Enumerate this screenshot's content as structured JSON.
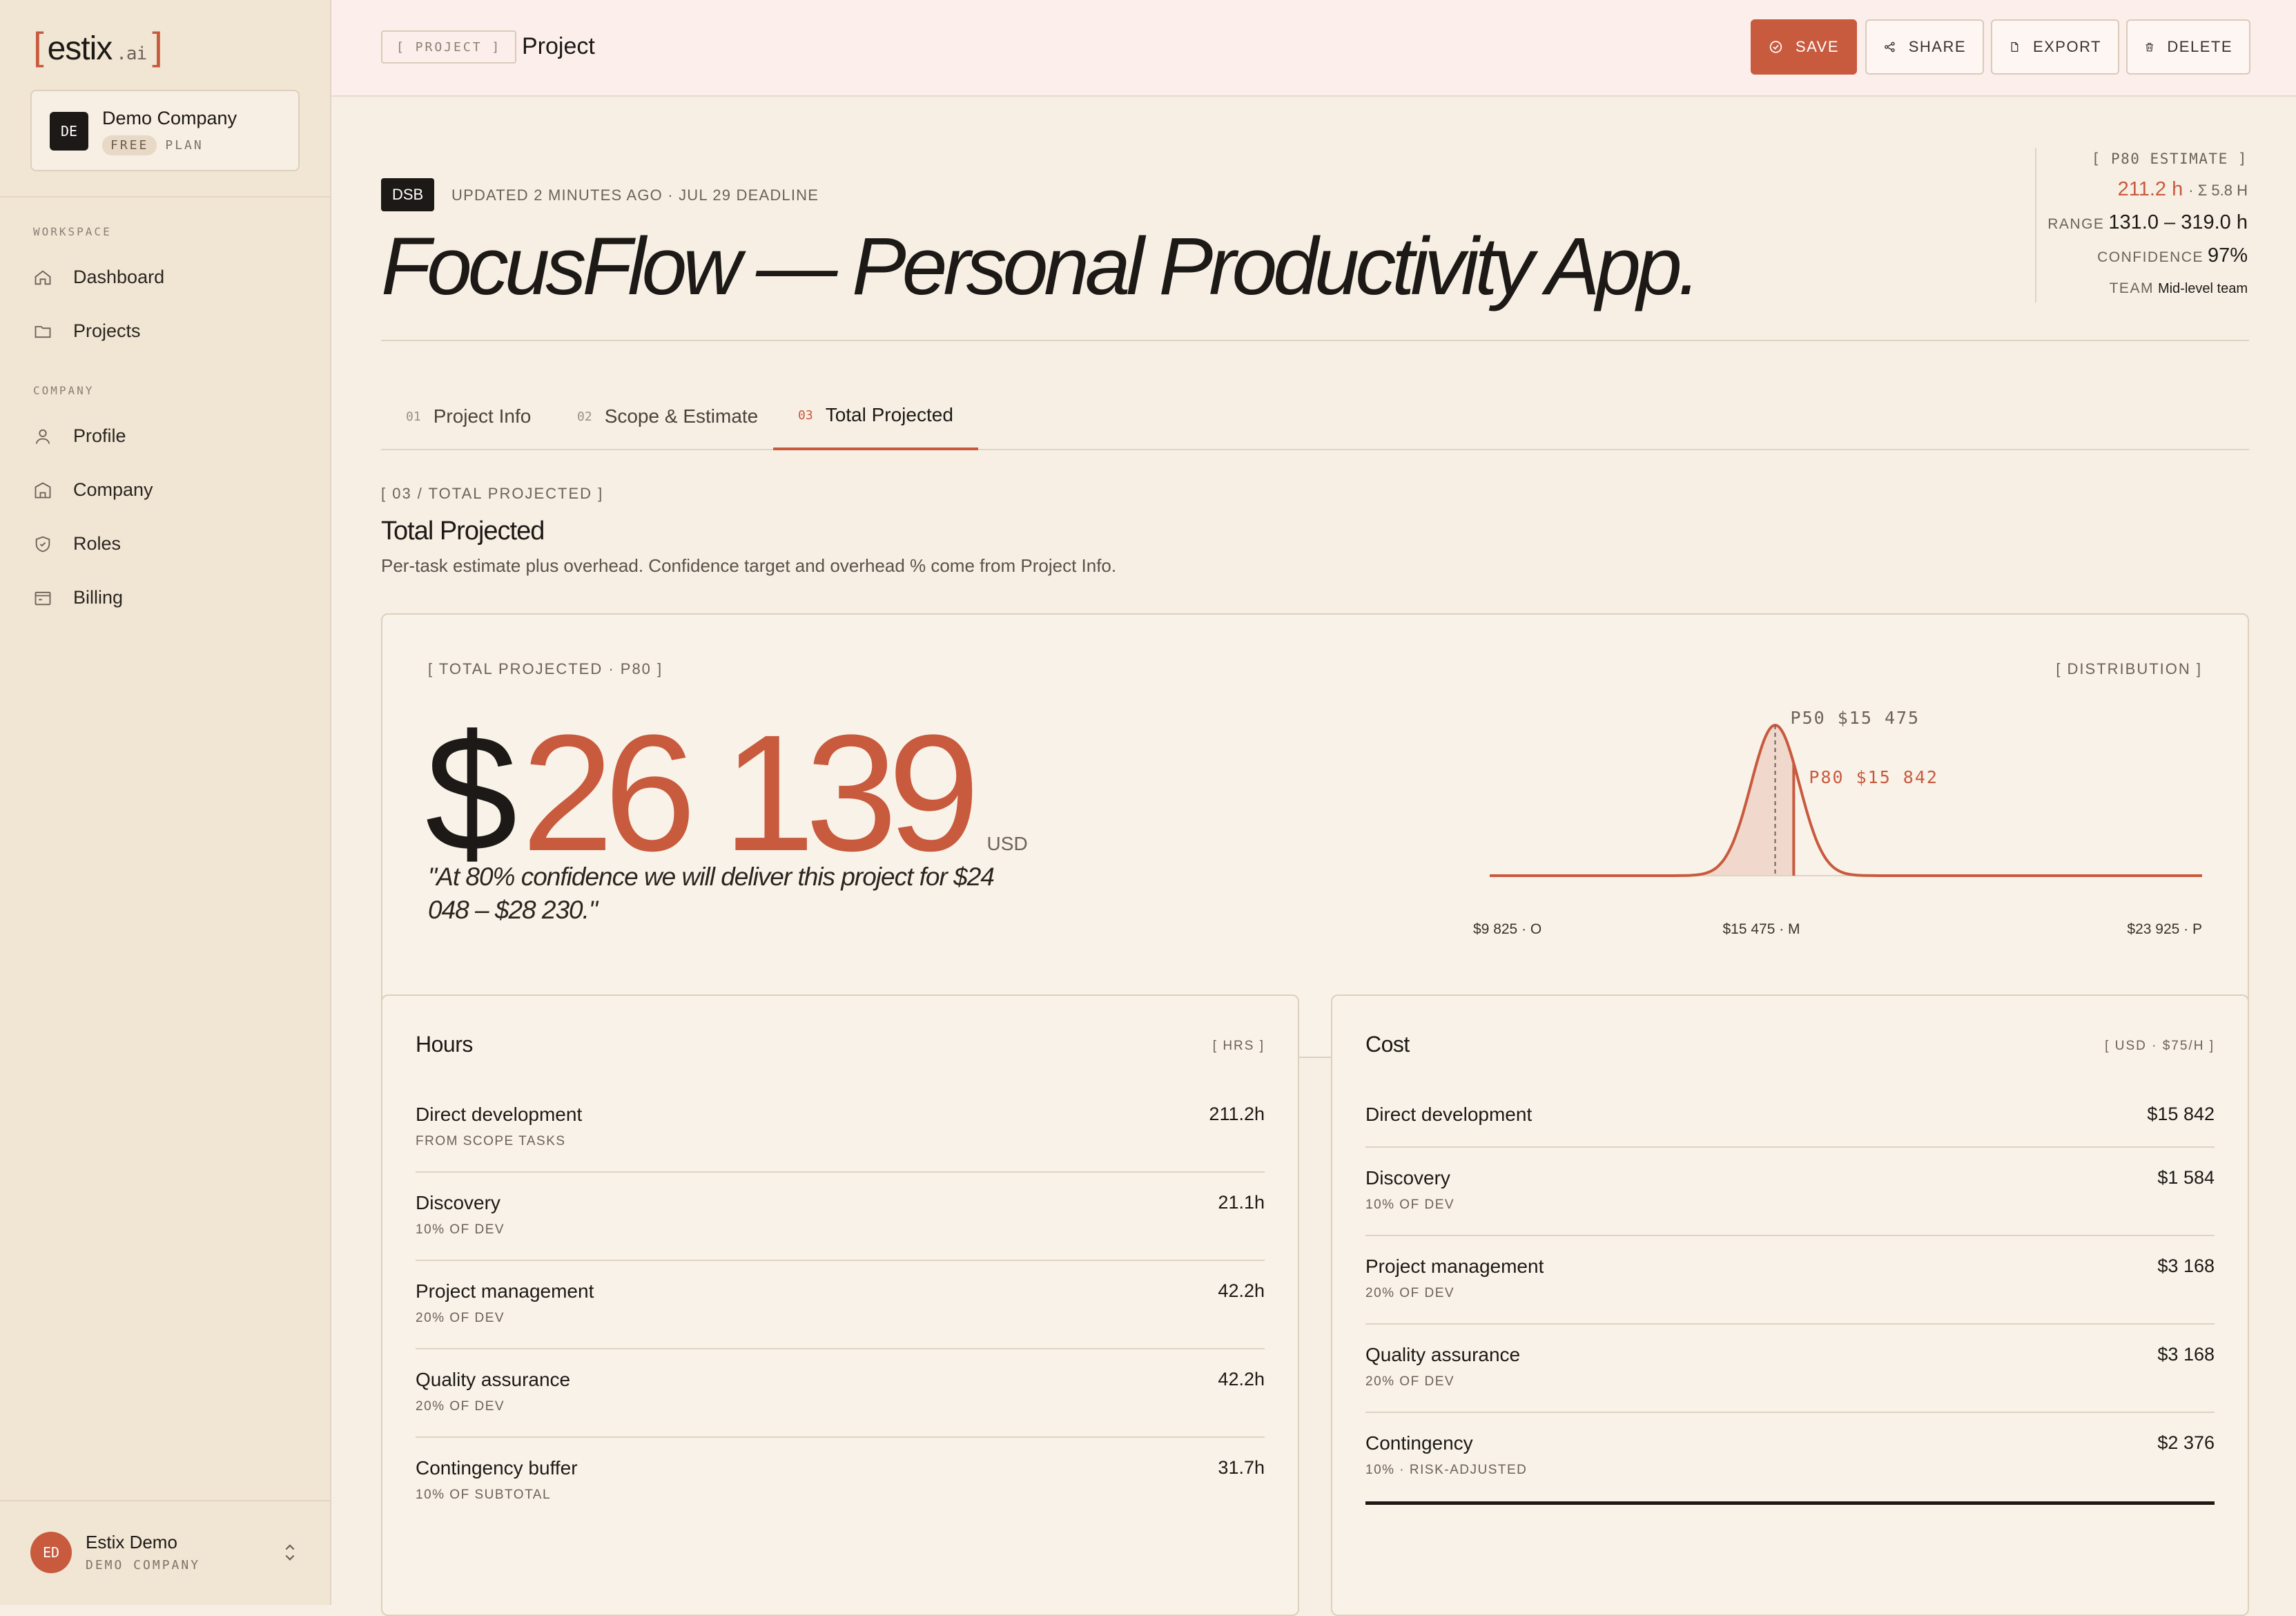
{
  "brand": {
    "name": "estix",
    "suffix": ".ai",
    "bracket_left": "[",
    "bracket_right": "]"
  },
  "company": {
    "initials": "DE",
    "name": "Demo Company",
    "plan_badge": "FREE",
    "plan_label": "PLAN"
  },
  "sidebar": {
    "workspace_label": "WORKSPACE",
    "company_label": "COMPANY",
    "items": [
      {
        "label": "Dashboard",
        "icon": "home-icon"
      },
      {
        "label": "Projects",
        "icon": "folder-icon"
      },
      {
        "label": "Profile",
        "icon": "user-icon"
      },
      {
        "label": "Company",
        "icon": "building-icon"
      },
      {
        "label": "Roles",
        "icon": "shield-icon"
      },
      {
        "label": "Billing",
        "icon": "wallet-icon"
      }
    ]
  },
  "user": {
    "initials": "ED",
    "name": "Estix Demo",
    "company": "DEMO COMPANY"
  },
  "topbar": {
    "crumb_tag": "[ PROJECT ]",
    "title": "Project",
    "buttons": {
      "save": "SAVE",
      "share": "SHARE",
      "export": "EXPORT",
      "delete": "DELETE"
    }
  },
  "project": {
    "code": "DSB",
    "updated": "UPDATED 2 MINUTES AGO · JUL 29 DEADLINE",
    "title": "FocusFlow — Personal Productivity App."
  },
  "estimate": {
    "label": "[ P80 ESTIMATE ]",
    "hours": "211.2 h",
    "sigma": "· Σ 5.8 H",
    "range_label": "RANGE",
    "range": "131.0 – 319.0 h",
    "confidence_label": "CONFIDENCE",
    "confidence": "97%",
    "team_label": "TEAM",
    "team": "Mid-level team"
  },
  "tabs": [
    {
      "num": "01",
      "label": "Project Info"
    },
    {
      "num": "02",
      "label": "Scope & Estimate"
    },
    {
      "num": "03",
      "label": "Total Projected"
    }
  ],
  "section": {
    "tag": "[ 03 / TOTAL PROJECTED ]",
    "title": "Total Projected",
    "desc": "Per-task estimate plus overhead. Confidence target and overhead % come from Project Info."
  },
  "total": {
    "tag": "[ TOTAL PROJECTED · P80 ]",
    "currency_symbol": "$",
    "value": "26 139",
    "unit": "USD",
    "quote": "\"At 80% confidence we will deliver this project for $24 048 – $28 230.\"",
    "dist_tag": "[ DISTRIBUTION ]"
  },
  "chart_data": {
    "type": "area",
    "x_min": 9825,
    "x_max": 23925,
    "x_ticks": [
      {
        "value": 9825,
        "label": "$9 825 · O"
      },
      {
        "value": 15475,
        "label": "$15 475 · M"
      },
      {
        "value": 23925,
        "label": "$23 925 · P"
      }
    ],
    "markers": [
      {
        "name": "P50",
        "value": 15475,
        "label": "P50 $15 475"
      },
      {
        "name": "P80",
        "value": 15842,
        "label": "P80 $15 842"
      }
    ],
    "mode": 15475,
    "spread": 480,
    "colors": {
      "curve": "#c85a3e",
      "fill": "#f0d8cc",
      "p50": "#6b6258"
    }
  },
  "hours_card": {
    "title": "Hours",
    "tag": "[ HRS ]",
    "rows": [
      {
        "label": "Direct development",
        "sub": "FROM SCOPE TASKS",
        "value": "211.2h"
      },
      {
        "label": "Discovery",
        "sub": "10% OF DEV",
        "value": "21.1h"
      },
      {
        "label": "Project management",
        "sub": "20% OF DEV",
        "value": "42.2h"
      },
      {
        "label": "Quality assurance",
        "sub": "20% OF DEV",
        "value": "42.2h"
      },
      {
        "label": "Contingency buffer",
        "sub": "10% OF SUBTOTAL",
        "value": "31.7h"
      }
    ]
  },
  "cost_card": {
    "title": "Cost",
    "tag": "[ USD · $75/H ]",
    "rows": [
      {
        "label": "Direct development",
        "sub": "",
        "value": "$15 842"
      },
      {
        "label": "Discovery",
        "sub": "10% OF DEV",
        "value": "$1 584"
      },
      {
        "label": "Project management",
        "sub": "20% OF DEV",
        "value": "$3 168"
      },
      {
        "label": "Quality assurance",
        "sub": "20% OF DEV",
        "value": "$3 168"
      },
      {
        "label": "Contingency",
        "sub": "10% · RISK-ADJUSTED",
        "value": "$2 376"
      }
    ]
  },
  "colors": {
    "accent": "#c85a3e",
    "ink": "#1c1916",
    "sidebar_bg": "#f1e6d4",
    "page_bg": "#f7efe4",
    "topbar_bg": "#fbeeeb"
  }
}
